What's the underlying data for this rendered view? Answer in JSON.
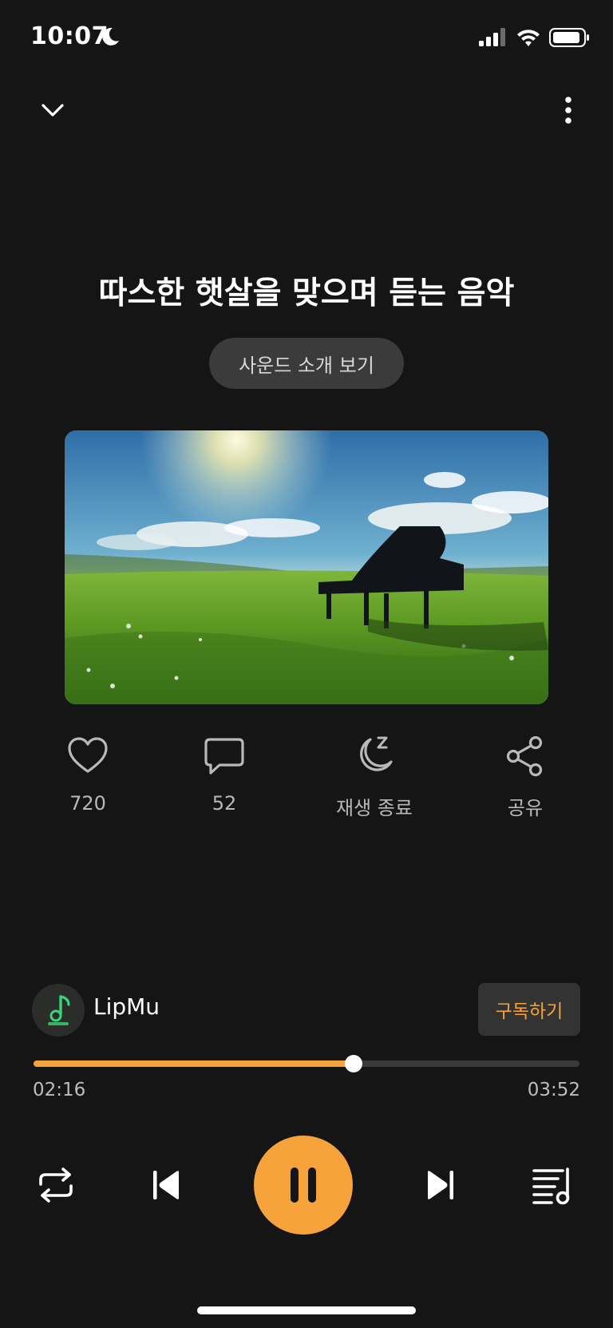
{
  "status_bar": {
    "time": "10:07"
  },
  "player": {
    "title": "따스한 햇살을 맞으며 듣는 음악",
    "intro_button_label": "사운드 소개 보기"
  },
  "actions": {
    "like_count": "720",
    "comment_count": "52",
    "sleep_timer_label": "재생 종료",
    "share_label": "공유"
  },
  "channel": {
    "name": "LipMu",
    "subscribe_label": "구독하기"
  },
  "playback": {
    "elapsed": "02:16",
    "total": "03:52",
    "progress_fraction": 0.586,
    "accent_color": "#f5a33a"
  },
  "icons": {
    "collapse": "chevron-down-icon",
    "more": "more-vertical-icon",
    "like": "heart-icon",
    "comment": "comment-icon",
    "sleep": "moon-z-icon",
    "share": "share-icon",
    "repeat": "repeat-icon",
    "previous": "skip-previous-icon",
    "pause": "pause-icon",
    "next": "skip-next-icon",
    "playlist": "playlist-icon"
  }
}
